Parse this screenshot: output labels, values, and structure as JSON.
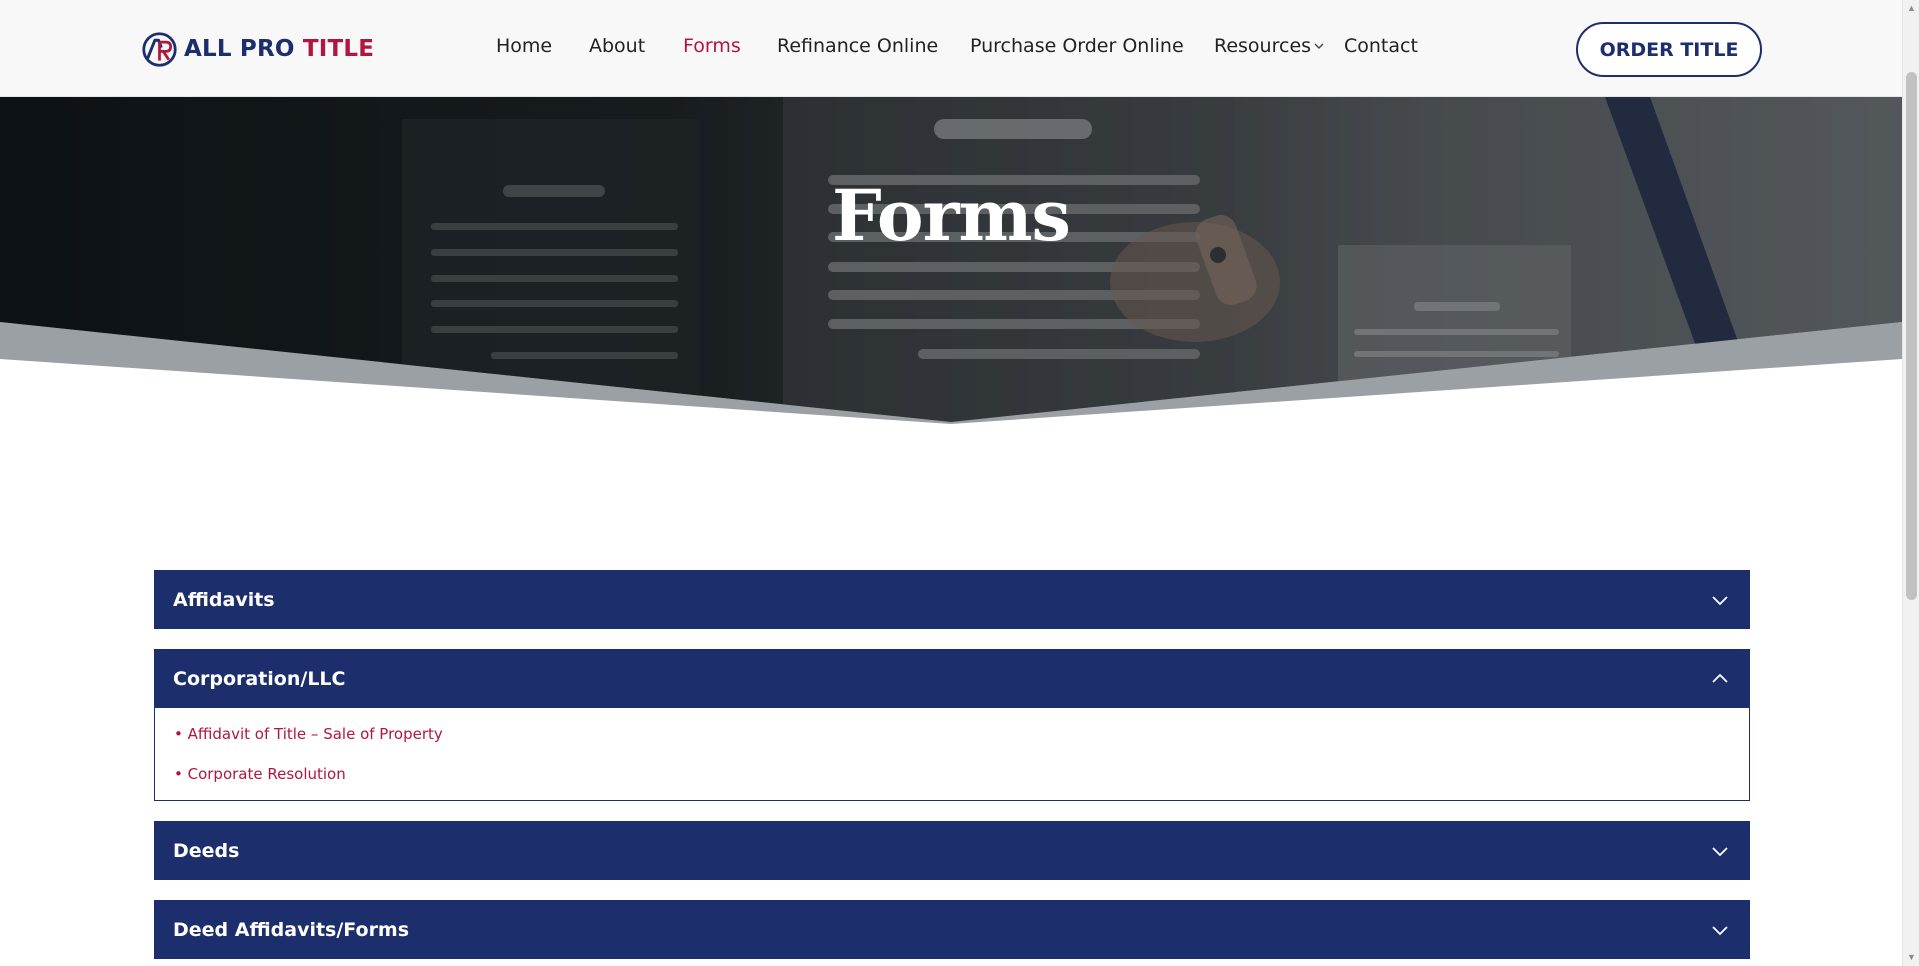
{
  "header": {
    "logo_initials": "AP",
    "logo_word1": "ALL PRO",
    "logo_word2": "TITLE",
    "nav": {
      "home": "Home",
      "about": "About",
      "forms": "Forms",
      "refinance": "Refinance Online",
      "purchase": "Purchase Order Online",
      "resources": "Resources",
      "contact": "Contact"
    },
    "active_nav": "Forms",
    "cta_label": "ORDER TITLE"
  },
  "hero": {
    "title": "Forms"
  },
  "accordion": {
    "sections": [
      {
        "title": "Affidavits",
        "expanded": false
      },
      {
        "title": "Corporation/LLC",
        "expanded": true,
        "links": [
          "• Affidavit of Title – Sale of Property",
          "• Corporate Resolution"
        ]
      },
      {
        "title": "Deeds",
        "expanded": false
      },
      {
        "title": "Deed Affidavits/Forms",
        "expanded": false
      }
    ]
  },
  "colors": {
    "navy": "#1c2e6b",
    "accent_red": "#b0163f",
    "header_bg": "#f8f8f8"
  },
  "icons": {
    "nav_dropdown": "chevron-down-icon",
    "accordion_collapsed": "chevron-down-icon",
    "accordion_expanded": "chevron-up-icon"
  }
}
